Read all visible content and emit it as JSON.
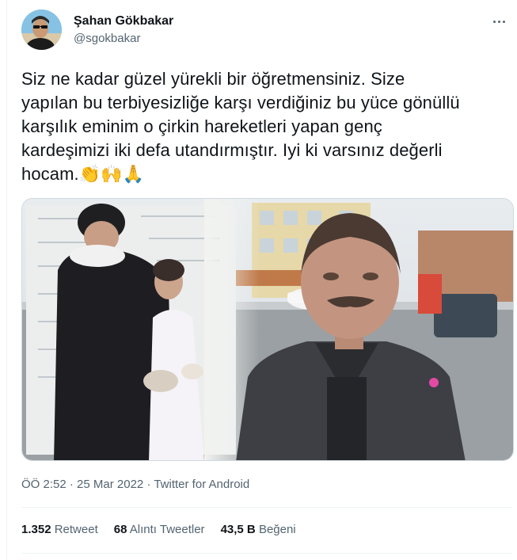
{
  "author": {
    "name": "Şahan Gökbakar",
    "handle": "@sgokbakar",
    "avatar_icon": "profile-photo"
  },
  "more_icon": "more-horizontal-icon",
  "tweet": {
    "lines": [
      "Siz ne kadar güzel yürekli bir öğretmensiniz. Size",
      "yapılan bu terbiyesizliğe karşı verdiğiniz bu yüce gönüllü",
      "karşılık eminim o çirkin hareketleri yapan genç",
      "kardeşimizi iki defa utandırmıştır. Iyi ki varsınız değerli",
      "hocam."
    ],
    "emojis": "👏🙌🙏"
  },
  "media": {
    "type": "photo-collage"
  },
  "meta": {
    "time": "ÖÖ 2:52",
    "separator": " · ",
    "date": "25 Mar 2022",
    "client": "Twitter for Android"
  },
  "stats": {
    "retweets_count": "1.352",
    "retweets_label": "Retweet",
    "quotes_count": "68",
    "quotes_label": "Alıntı Tweetler",
    "likes_count": "43,5 B",
    "likes_label": "Beğeni"
  },
  "colors": {
    "text": "#0f1419",
    "secondary": "#536471",
    "border": "#cfd9de",
    "divider": "#eff3f4"
  }
}
